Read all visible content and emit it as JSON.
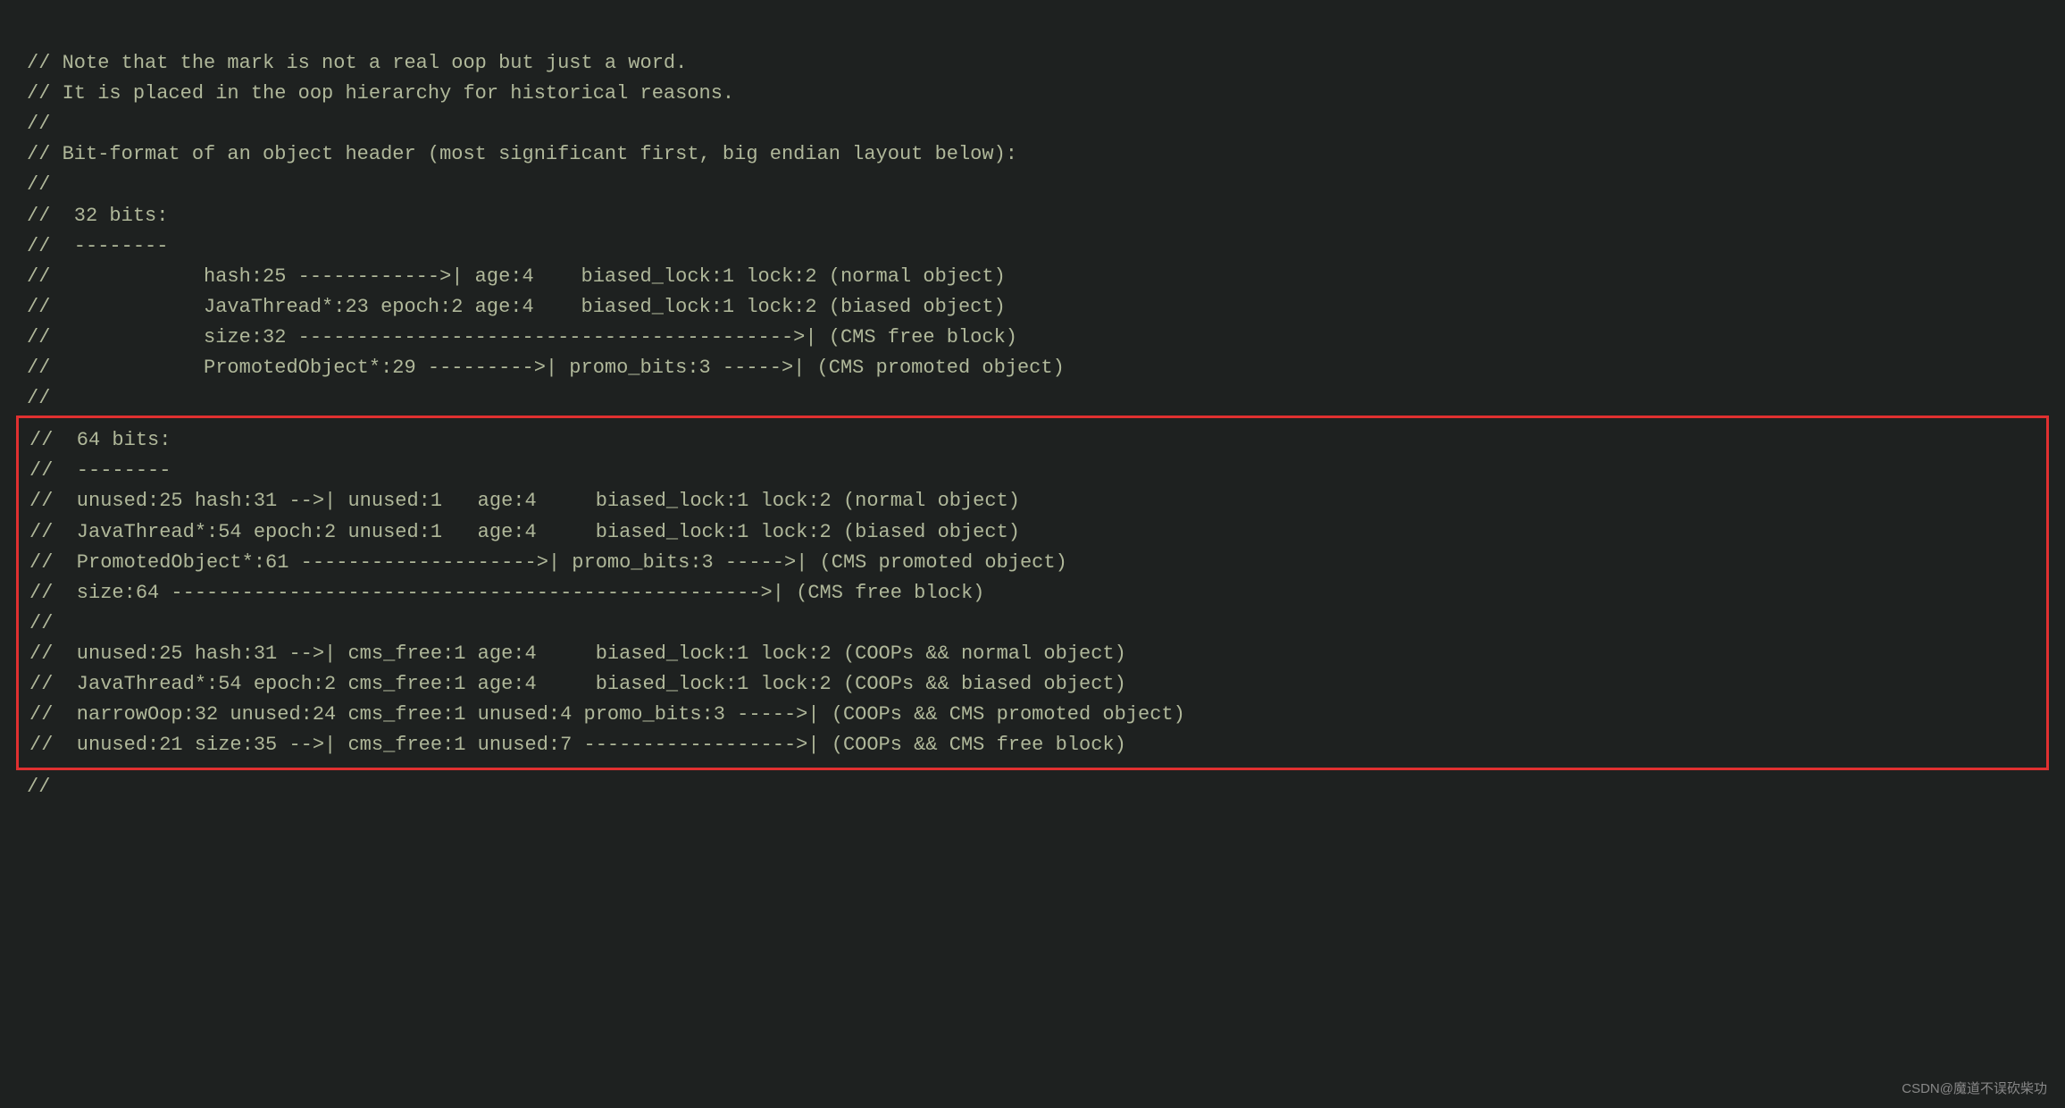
{
  "code": {
    "lines_before": [
      "// Note that the mark is not a real oop but just a word.",
      "// It is placed in the oop hierarchy for historical reasons.",
      "//",
      "// Bit-format of an object header (most significant first, big endian layout below):",
      "//",
      "//  32 bits:",
      "//  --------",
      "//             hash:25 ------------>| age:4    biased_lock:1 lock:2 (normal object)",
      "//             JavaThread*:23 epoch:2 age:4    biased_lock:1 lock:2 (biased object)",
      "//             size:32 ------------------------------------------>| (CMS free block)",
      "//             PromotedObject*:29 --------->| promo_bits:3 ----->| (CMS promoted object)",
      "//"
    ],
    "highlighted_lines": [
      "//  64 bits:",
      "//  --------",
      "//  unused:25 hash:31 -->| unused:1   age:4     biased_lock:1 lock:2 (normal object)",
      "//  JavaThread*:54 epoch:2 unused:1   age:4     biased_lock:1 lock:2 (biased object)",
      "//  PromotedObject*:61 -------------------->| promo_bits:3 ----->| (CMS promoted object)",
      "//  size:64 -------------------------------------------------->| (CMS free block)",
      "//",
      "//  unused:25 hash:31 -->| cms_free:1 age:4     biased_lock:1 lock:2 (COOPs && normal object)",
      "//  JavaThread*:54 epoch:2 cms_free:1 age:4     biased_lock:1 lock:2 (COOPs && biased object)",
      "//  narrowOop:32 unused:24 cms_free:1 unused:4 promo_bits:3 ----->| (COOPs && CMS promoted object)",
      "//  unused:21 size:35 -->| cms_free:1 unused:7 ------------------>| (COOPs && CMS free block)"
    ],
    "lines_after": [
      "//"
    ]
  },
  "watermark": "CSDN@魔道不误砍柴功"
}
